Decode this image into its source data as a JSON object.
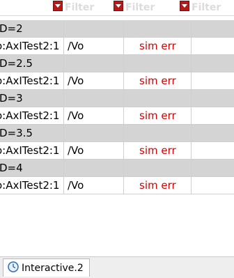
{
  "filters": [
    {
      "placeholder": "Filter"
    },
    {
      "placeholder": "Filter"
    },
    {
      "placeholder": "Filter"
    }
  ],
  "rows": [
    {
      "group": "D=2",
      "name": "o:AxITest2:1",
      "output": "/Vo",
      "status": "sim err"
    },
    {
      "group": "D=2.5",
      "name": "o:AxITest2:1",
      "output": "/Vo",
      "status": "sim err"
    },
    {
      "group": "D=3",
      "name": "o:AxITest2:1",
      "output": "/Vo",
      "status": "sim err"
    },
    {
      "group": "D=3.5",
      "name": "o:AxITest2:1",
      "output": "/Vo",
      "status": "sim err"
    },
    {
      "group": "D=4",
      "name": "o:AxITest2:1",
      "output": "/Vo",
      "status": "sim err"
    }
  ],
  "tab": {
    "label": "Interactive.2",
    "icon": "clock-icon"
  },
  "colors": {
    "error": "#d40000",
    "group_bg": "#d4d4d4",
    "filter_btn": "#b31b1b"
  }
}
